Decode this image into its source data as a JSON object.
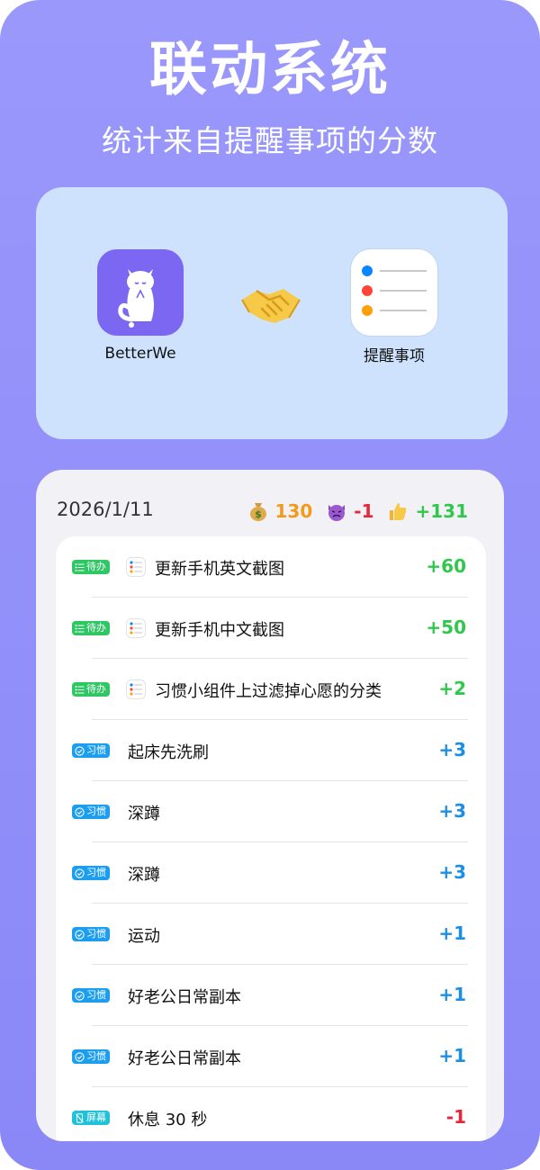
{
  "header": {
    "title": "联动系统",
    "subtitle": "统计来自提醒事项的分数"
  },
  "apps": {
    "left_label": "BetterWe",
    "right_label": "提醒事项"
  },
  "summary": {
    "date": "2026/1/11",
    "income": "130",
    "penalty": "-1",
    "total": "+131",
    "colors": {
      "income": "#f39a1b",
      "penalty": "#e8263a",
      "total": "#2fc84c"
    }
  },
  "items": [
    {
      "tag": "待办",
      "tag_icon": "list-icon",
      "tag_color": "#2ec764",
      "has_reminder_icon": true,
      "text": "更新手机英文截图",
      "score": "+60",
      "score_color": "#2fc84c"
    },
    {
      "tag": "待办",
      "tag_icon": "list-icon",
      "tag_color": "#2ec764",
      "has_reminder_icon": true,
      "text": "更新手机中文截图",
      "score": "+50",
      "score_color": "#2fc84c"
    },
    {
      "tag": "待办",
      "tag_icon": "list-icon",
      "tag_color": "#2ec764",
      "has_reminder_icon": true,
      "text": "习惯小组件上过滤掉心愿的分类",
      "score": "+2",
      "score_color": "#2fc84c"
    },
    {
      "tag": "习惯",
      "tag_icon": "check-circle-icon",
      "tag_color": "#1b9ef0",
      "has_reminder_icon": false,
      "text": "起床先洗刷",
      "score": "+3",
      "score_color": "#1b8fe6"
    },
    {
      "tag": "习惯",
      "tag_icon": "check-circle-icon",
      "tag_color": "#1b9ef0",
      "has_reminder_icon": false,
      "text": "深蹲",
      "score": "+3",
      "score_color": "#1b8fe6"
    },
    {
      "tag": "习惯",
      "tag_icon": "check-circle-icon",
      "tag_color": "#1b9ef0",
      "has_reminder_icon": false,
      "text": "深蹲",
      "score": "+3",
      "score_color": "#1b8fe6"
    },
    {
      "tag": "习惯",
      "tag_icon": "check-circle-icon",
      "tag_color": "#1b9ef0",
      "has_reminder_icon": false,
      "text": "运动",
      "score": "+1",
      "score_color": "#1b8fe6"
    },
    {
      "tag": "习惯",
      "tag_icon": "check-circle-icon",
      "tag_color": "#1b9ef0",
      "has_reminder_icon": false,
      "text": "好老公日常副本",
      "score": "+1",
      "score_color": "#1b8fe6"
    },
    {
      "tag": "习惯",
      "tag_icon": "check-circle-icon",
      "tag_color": "#1b9ef0",
      "has_reminder_icon": false,
      "text": "好老公日常副本",
      "score": "+1",
      "score_color": "#1b8fe6"
    },
    {
      "tag": "屏幕",
      "tag_icon": "phone-off-icon",
      "tag_color": "#1fc2d8",
      "has_reminder_icon": false,
      "text": "休息 30 秒",
      "score": "-1",
      "score_color": "#e8263a"
    }
  ]
}
